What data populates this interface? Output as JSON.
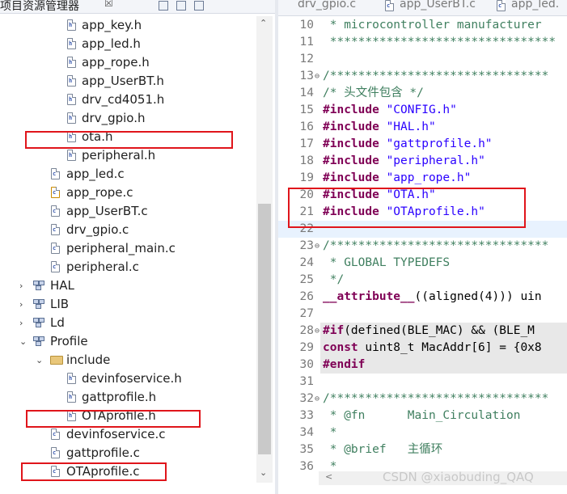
{
  "left_panel": {
    "title": "项目资源管理器",
    "close_glyph": "☒",
    "tree": [
      {
        "label": "app_key.h",
        "kind": "h-file"
      },
      {
        "label": "app_led.h",
        "kind": "h-file"
      },
      {
        "label": "app_rope.h",
        "kind": "h-file"
      },
      {
        "label": "app_UserBT.h",
        "kind": "h-file"
      },
      {
        "label": "drv_cd4051.h",
        "kind": "h-file"
      },
      {
        "label": "drv_gpio.h",
        "kind": "h-file"
      },
      {
        "label": "ota.h",
        "kind": "h-file"
      },
      {
        "label": "peripheral.h",
        "kind": "h-file"
      },
      {
        "label": "app_led.c",
        "kind": "c-file"
      },
      {
        "label": "app_rope.c",
        "kind": "c-file-warning"
      },
      {
        "label": "app_UserBT.c",
        "kind": "c-file"
      },
      {
        "label": "drv_gpio.c",
        "kind": "c-file"
      },
      {
        "label": "peripheral_main.c",
        "kind": "c-file"
      },
      {
        "label": "peripheral.c",
        "kind": "c-file"
      },
      {
        "label": "HAL",
        "kind": "library-folder",
        "expander": "collapsed"
      },
      {
        "label": "LIB",
        "kind": "library-folder",
        "expander": "collapsed"
      },
      {
        "label": "Ld",
        "kind": "library-folder",
        "expander": "collapsed"
      },
      {
        "label": "Profile",
        "kind": "library-folder",
        "expander": "expanded"
      },
      {
        "label": "include",
        "kind": "folder",
        "expander": "expanded"
      },
      {
        "label": "devinfoservice.h",
        "kind": "h-file"
      },
      {
        "label": "gattprofile.h",
        "kind": "h-file"
      },
      {
        "label": "OTAprofile.h",
        "kind": "h-file"
      },
      {
        "label": "devinfoservice.c",
        "kind": "c-file"
      },
      {
        "label": "gattprofile.c",
        "kind": "c-file"
      },
      {
        "label": "OTAprofile.c",
        "kind": "c-file"
      }
    ],
    "file_icon_letters": {
      "h": "h",
      "c": "c"
    }
  },
  "editor": {
    "tabs": [
      {
        "label": "drv_gpio.c"
      },
      {
        "label": "app_UserBT.c"
      },
      {
        "label": "app_led."
      }
    ],
    "lines": [
      {
        "n": "10",
        "parts": [
          {
            "c": "cmt",
            "t": " * microcontroller manufacturer"
          }
        ]
      },
      {
        "n": "11",
        "parts": [
          {
            "c": "cmt",
            "t": " ********************************"
          }
        ]
      },
      {
        "n": "12",
        "parts": []
      },
      {
        "n": "13",
        "fold": "⊖",
        "parts": [
          {
            "c": "cmt",
            "t": "/*******************************"
          }
        ]
      },
      {
        "n": "14",
        "parts": [
          {
            "c": "cmt",
            "t": "/* 头文件包含 */"
          }
        ]
      },
      {
        "n": "15",
        "parts": [
          {
            "c": "pp",
            "t": "#include "
          },
          {
            "c": "str",
            "t": "\"CONFIG.h\""
          }
        ]
      },
      {
        "n": "16",
        "parts": [
          {
            "c": "pp",
            "t": "#include "
          },
          {
            "c": "str",
            "t": "\"HAL.h\""
          }
        ]
      },
      {
        "n": "17",
        "parts": [
          {
            "c": "pp",
            "t": "#include "
          },
          {
            "c": "str",
            "t": "\"gattprofile.h\""
          }
        ]
      },
      {
        "n": "18",
        "parts": [
          {
            "c": "pp",
            "t": "#include "
          },
          {
            "c": "str",
            "t": "\"peripheral.h\""
          }
        ]
      },
      {
        "n": "19",
        "parts": [
          {
            "c": "pp",
            "t": "#include "
          },
          {
            "c": "str",
            "t": "\"app_rope.h\""
          }
        ]
      },
      {
        "n": "20",
        "parts": [
          {
            "c": "pp",
            "t": "#include "
          },
          {
            "c": "str",
            "t": "\"OTA.h\""
          }
        ]
      },
      {
        "n": "21",
        "parts": [
          {
            "c": "pp",
            "t": "#include "
          },
          {
            "c": "str",
            "t": "\"OTAprofile.h\""
          }
        ]
      },
      {
        "n": "22",
        "current": true,
        "parts": []
      },
      {
        "n": "23",
        "fold": "⊖",
        "parts": [
          {
            "c": "cmt",
            "t": "/*******************************"
          }
        ]
      },
      {
        "n": "24",
        "parts": [
          {
            "c": "cmt",
            "t": " * GLOBAL TYPEDEFS"
          }
        ]
      },
      {
        "n": "25",
        "parts": [
          {
            "c": "cmt",
            "t": " */"
          }
        ]
      },
      {
        "n": "26",
        "parts": [
          {
            "c": "kw",
            "t": "__attribute__"
          },
          {
            "c": "tx",
            "t": "((aligned(4))) uin"
          }
        ]
      },
      {
        "n": "27",
        "parts": []
      },
      {
        "n": "28",
        "fold": "⊖",
        "hl": true,
        "parts": [
          {
            "c": "pp",
            "t": "#if"
          },
          {
            "c": "tx",
            "t": "(defined(BLE_MAC) && (BLE_M"
          }
        ]
      },
      {
        "n": "29",
        "hl": true,
        "parts": [
          {
            "c": "kw",
            "t": "const"
          },
          {
            "c": "tx",
            "t": " uint8_t MacAddr[6] = {0x8"
          }
        ]
      },
      {
        "n": "30",
        "hl": true,
        "parts": [
          {
            "c": "pp",
            "t": "#endif"
          }
        ]
      },
      {
        "n": "31",
        "parts": []
      },
      {
        "n": "32",
        "fold": "⊖",
        "parts": [
          {
            "c": "cmt",
            "t": "/*******************************"
          }
        ]
      },
      {
        "n": "33",
        "parts": [
          {
            "c": "cmt",
            "t": " * @fn      Main_Circulation"
          }
        ]
      },
      {
        "n": "34",
        "parts": [
          {
            "c": "cmt",
            "t": " *"
          }
        ]
      },
      {
        "n": "35",
        "parts": [
          {
            "c": "cmt",
            "t": " * @brief   主循环"
          }
        ]
      },
      {
        "n": "36",
        "parts": [
          {
            "c": "cmt",
            "t": " *"
          }
        ]
      }
    ]
  },
  "watermark": "CSDN @xiaobuding_QAQ",
  "colors": {
    "annotation_red": "#e0151b",
    "comment_green": "#3f7f5f",
    "preprocessor_purple": "#7f0055",
    "string_blue": "#2a00ff"
  }
}
